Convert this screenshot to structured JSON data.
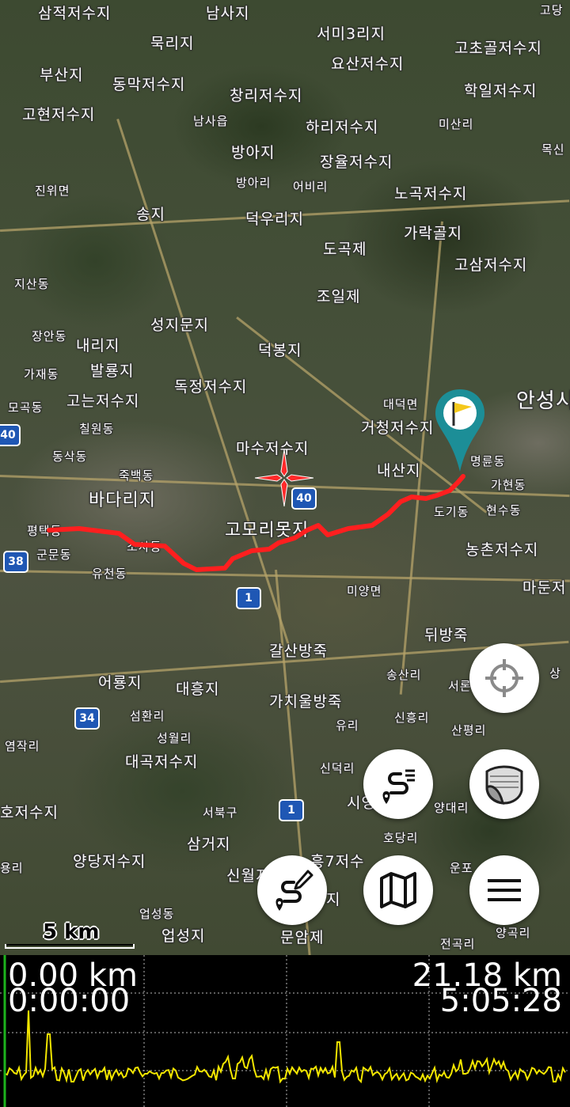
{
  "map": {
    "type": "satellite",
    "route_color": "#ff1f1f",
    "marker_color": "#1c8e97",
    "places": [
      {
        "text": "삼적저수지"
      },
      {
        "text": "남사지"
      },
      {
        "text": "서미3리지"
      },
      {
        "text": "고당"
      },
      {
        "text": "묵리지"
      },
      {
        "text": "요산저수지"
      },
      {
        "text": "고초골저수지"
      },
      {
        "text": "부산지"
      },
      {
        "text": "동막저수지"
      },
      {
        "text": "학일저수지"
      },
      {
        "text": "창리저수지"
      },
      {
        "text": "고현저수지"
      },
      {
        "text": "남사읍"
      },
      {
        "text": "하리저수지"
      },
      {
        "text": "미산리"
      },
      {
        "text": "목신"
      },
      {
        "text": "방아지"
      },
      {
        "text": "장율저수지"
      },
      {
        "text": "진위면"
      },
      {
        "text": "방아리"
      },
      {
        "text": "어비리"
      },
      {
        "text": "노곡저수지"
      },
      {
        "text": "송지"
      },
      {
        "text": "덕우리지"
      },
      {
        "text": "가락골지"
      },
      {
        "text": "도곡제"
      },
      {
        "text": "고삼저수지"
      },
      {
        "text": "지산동"
      },
      {
        "text": "조일제"
      },
      {
        "text": "성지문지"
      },
      {
        "text": "장안동"
      },
      {
        "text": "내리지"
      },
      {
        "text": "덕봉지"
      },
      {
        "text": "가재동"
      },
      {
        "text": "발룡지"
      },
      {
        "text": "독정저수지"
      },
      {
        "text": "고는저수지"
      },
      {
        "text": "모곡동"
      },
      {
        "text": "칠원동"
      },
      {
        "text": "대덕면"
      },
      {
        "text": "안성시"
      },
      {
        "text": "거청저수지"
      },
      {
        "text": "마수저수지"
      },
      {
        "text": "동삭동"
      },
      {
        "text": "죽백동"
      },
      {
        "text": "내산지"
      },
      {
        "text": "명륜동"
      },
      {
        "text": "바다리지"
      },
      {
        "text": "가현동"
      },
      {
        "text": "도기동"
      },
      {
        "text": "현수동"
      },
      {
        "text": "고모리못지"
      },
      {
        "text": "평택동"
      },
      {
        "text": "군문동"
      },
      {
        "text": "소사동"
      },
      {
        "text": "농촌저수지"
      },
      {
        "text": "유천동"
      },
      {
        "text": "미양면"
      },
      {
        "text": "마둔저"
      },
      {
        "text": "뒤방죽"
      },
      {
        "text": "갈산방죽"
      },
      {
        "text": "송산리"
      },
      {
        "text": "서론"
      },
      {
        "text": "상"
      },
      {
        "text": "어룡지"
      },
      {
        "text": "대흥지"
      },
      {
        "text": "가치울방죽"
      },
      {
        "text": "섬환리"
      },
      {
        "text": "신흥리"
      },
      {
        "text": "유리"
      },
      {
        "text": "염작리"
      },
      {
        "text": "산평리"
      },
      {
        "text": "성월리"
      },
      {
        "text": "대곡저수지"
      },
      {
        "text": "신덕리"
      },
      {
        "text": "양대리"
      },
      {
        "text": "호저수지"
      },
      {
        "text": "서북구"
      },
      {
        "text": "시영"
      },
      {
        "text": "호당리"
      },
      {
        "text": "삼거지"
      },
      {
        "text": "양당저수지"
      },
      {
        "text": "흥7저수"
      },
      {
        "text": "용리"
      },
      {
        "text": "신월지"
      },
      {
        "text": "운포"
      },
      {
        "text": "업성동"
      },
      {
        "text": "지"
      },
      {
        "text": "양곡리"
      },
      {
        "text": "업성지"
      },
      {
        "text": "문암제"
      },
      {
        "text": "전곡리"
      }
    ],
    "shields": [
      {
        "text": "40"
      },
      {
        "text": "40"
      },
      {
        "text": "38"
      },
      {
        "text": "1"
      },
      {
        "text": "34"
      },
      {
        "text": "1"
      }
    ],
    "scale_label": "5 km"
  },
  "buttons": {
    "locate_icon": "crosshair-icon",
    "route_list_icon": "route-list-icon",
    "layers_icon": "map-layers-icon",
    "draw_route_icon": "draw-route-icon",
    "map_icon": "folded-map-icon",
    "menu_icon": "hamburger-menu-icon"
  },
  "profile": {
    "left_distance": "0.00 km",
    "left_time": "0:00:00",
    "right_distance": "21.18 km",
    "right_time": "5:05:28",
    "graph_color": "#f3e600",
    "cursor_color": "#1db31d"
  }
}
